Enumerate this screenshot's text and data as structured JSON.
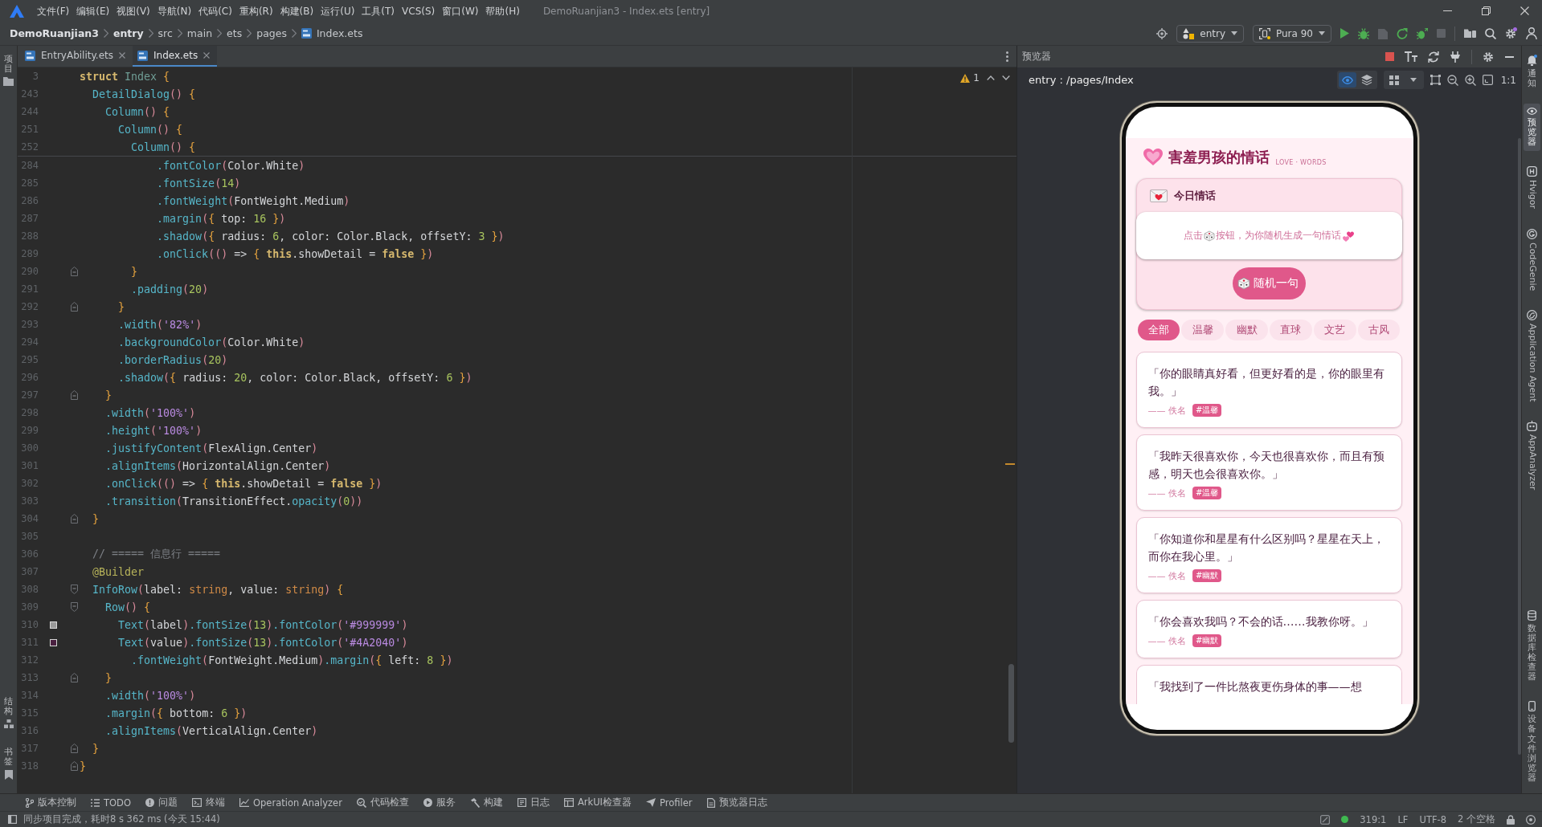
{
  "menu_bar": {
    "items": [
      "文件(F)",
      "编辑(E)",
      "视图(V)",
      "导航(N)",
      "代码(C)",
      "重构(R)",
      "构建(B)",
      "运行(U)",
      "工具(T)",
      "VCS(S)",
      "窗口(W)",
      "帮助(H)"
    ],
    "title": "DemoRuanjian3 - Index.ets [entry]"
  },
  "nav_bar": {
    "breadcrumbs": [
      {
        "label": "DemoRuanjian3",
        "bold": true,
        "kind": "folder"
      },
      {
        "label": "entry",
        "bold": true,
        "kind": "folder"
      },
      {
        "label": "src",
        "bold": false,
        "kind": "folder"
      },
      {
        "label": "main",
        "bold": false,
        "kind": "folder"
      },
      {
        "label": "ets",
        "bold": false,
        "kind": "folder"
      },
      {
        "label": "pages",
        "bold": false,
        "kind": "folder"
      },
      {
        "label": "Index.ets",
        "bold": false,
        "kind": "file"
      }
    ],
    "module": "entry",
    "device": "Pura 90"
  },
  "left_stripe": {
    "top_items": [
      "项目"
    ],
    "bottom_items": [
      "结构",
      "书签"
    ]
  },
  "editor": {
    "tabs": [
      {
        "label": "EntryAbility.ets",
        "selected": false
      },
      {
        "label": "Index.ets",
        "selected": true
      }
    ],
    "warning_count": "1",
    "sticky_lines": [
      {
        "number": "3",
        "tokens": [
          {
            "kind": "kw",
            "text": "struct"
          },
          {
            "kind": "type",
            "text": " Index"
          },
          {
            "kind": "brace",
            "text": " {"
          }
        ]
      },
      {
        "number": "243",
        "tokens": [
          {
            "kind": "fn",
            "text": "  DetailDialog"
          },
          {
            "kind": "paren",
            "text": "()"
          },
          {
            "kind": "brace",
            "text": " {"
          }
        ]
      },
      {
        "number": "244",
        "tokens": [
          {
            "kind": "fn",
            "text": "    Column"
          },
          {
            "kind": "paren",
            "text": "()"
          },
          {
            "kind": "brace",
            "text": " {"
          }
        ]
      },
      {
        "number": "251",
        "tokens": [
          {
            "kind": "fn",
            "text": "      Column"
          },
          {
            "kind": "paren",
            "text": "()"
          },
          {
            "kind": "brace",
            "text": " {"
          }
        ]
      },
      {
        "number": "252",
        "tokens": [
          {
            "kind": "fn",
            "text": "        Column"
          },
          {
            "kind": "paren",
            "text": "()"
          },
          {
            "kind": "brace",
            "text": " {"
          }
        ]
      }
    ],
    "lines": [
      {
        "number": "284",
        "kind": "plain",
        "tokens": [
          {
            "kind": "fn",
            "text": "            .fontColor"
          },
          {
            "kind": "paren",
            "text": "("
          },
          {
            "kind": "id",
            "text": "Color.White"
          },
          {
            "kind": "paren",
            "text": ")"
          }
        ]
      },
      {
        "number": "285",
        "kind": "plain",
        "tokens": [
          {
            "kind": "fn",
            "text": "            .fontSize"
          },
          {
            "kind": "paren",
            "text": "("
          },
          {
            "kind": "num",
            "text": "14"
          },
          {
            "kind": "paren",
            "text": ")"
          }
        ]
      },
      {
        "number": "286",
        "kind": "plain",
        "tokens": [
          {
            "kind": "fn",
            "text": "            .fontWeight"
          },
          {
            "kind": "paren",
            "text": "("
          },
          {
            "kind": "id",
            "text": "FontWeight.Medium"
          },
          {
            "kind": "paren",
            "text": ")"
          }
        ]
      },
      {
        "number": "287",
        "kind": "plain",
        "tokens": [
          {
            "kind": "fn",
            "text": "            .margin"
          },
          {
            "kind": "paren",
            "text": "("
          },
          {
            "kind": "brace",
            "text": "{"
          },
          {
            "kind": "id",
            "text": " top: "
          },
          {
            "kind": "num",
            "text": "16"
          },
          {
            "kind": "brace",
            "text": " }"
          },
          {
            "kind": "paren",
            "text": ")"
          }
        ]
      },
      {
        "number": "288",
        "kind": "plain",
        "tokens": [
          {
            "kind": "fn",
            "text": "            .shadow"
          },
          {
            "kind": "paren",
            "text": "("
          },
          {
            "kind": "brace",
            "text": "{"
          },
          {
            "kind": "id",
            "text": " radius: "
          },
          {
            "kind": "num",
            "text": "6"
          },
          {
            "kind": "id",
            "text": ", color: Color.Black, offsetY: "
          },
          {
            "kind": "num",
            "text": "3"
          },
          {
            "kind": "brace",
            "text": " }"
          },
          {
            "kind": "paren",
            "text": ")"
          }
        ]
      },
      {
        "number": "289",
        "kind": "plain",
        "tokens": [
          {
            "kind": "fn",
            "text": "            .onClick"
          },
          {
            "kind": "paren",
            "text": "(()"
          },
          {
            "kind": "id",
            "text": " => "
          },
          {
            "kind": "brace",
            "text": "{"
          },
          {
            "kind": "kw",
            "text": " this"
          },
          {
            "kind": "id",
            "text": ".showDetail = "
          },
          {
            "kind": "kw",
            "text": "false"
          },
          {
            "kind": "brace",
            "text": " }"
          },
          {
            "kind": "paren",
            "text": ")"
          }
        ]
      },
      {
        "number": "290",
        "kind": "closer",
        "tokens": [
          {
            "kind": "brace",
            "text": "        }"
          }
        ]
      },
      {
        "number": "291",
        "kind": "plain",
        "tokens": [
          {
            "kind": "fn",
            "text": "        .padding"
          },
          {
            "kind": "paren",
            "text": "("
          },
          {
            "kind": "num",
            "text": "20"
          },
          {
            "kind": "paren",
            "text": ")"
          }
        ]
      },
      {
        "number": "292",
        "kind": "closer",
        "tokens": [
          {
            "kind": "brace",
            "text": "      }"
          }
        ]
      },
      {
        "number": "293",
        "kind": "plain",
        "tokens": [
          {
            "kind": "fn",
            "text": "      .width"
          },
          {
            "kind": "paren",
            "text": "("
          },
          {
            "kind": "str",
            "text": "'82%'"
          },
          {
            "kind": "paren",
            "text": ")"
          }
        ]
      },
      {
        "number": "294",
        "kind": "plain",
        "tokens": [
          {
            "kind": "fn",
            "text": "      .backgroundColor"
          },
          {
            "kind": "paren",
            "text": "("
          },
          {
            "kind": "id",
            "text": "Color.White"
          },
          {
            "kind": "paren",
            "text": ")"
          }
        ]
      },
      {
        "number": "295",
        "kind": "plain",
        "tokens": [
          {
            "kind": "fn",
            "text": "      .borderRadius"
          },
          {
            "kind": "paren",
            "text": "("
          },
          {
            "kind": "num",
            "text": "20"
          },
          {
            "kind": "paren",
            "text": ")"
          }
        ]
      },
      {
        "number": "296",
        "kind": "plain",
        "tokens": [
          {
            "kind": "fn",
            "text": "      .shadow"
          },
          {
            "kind": "paren",
            "text": "("
          },
          {
            "kind": "brace",
            "text": "{"
          },
          {
            "kind": "id",
            "text": " radius: "
          },
          {
            "kind": "num",
            "text": "20"
          },
          {
            "kind": "id",
            "text": ", color: Color.Black, offsetY: "
          },
          {
            "kind": "num",
            "text": "6"
          },
          {
            "kind": "brace",
            "text": " }"
          },
          {
            "kind": "paren",
            "text": ")"
          }
        ]
      },
      {
        "number": "297",
        "kind": "closer",
        "tokens": [
          {
            "kind": "brace",
            "text": "    }"
          }
        ]
      },
      {
        "number": "298",
        "kind": "plain",
        "tokens": [
          {
            "kind": "fn",
            "text": "    .width"
          },
          {
            "kind": "paren",
            "text": "("
          },
          {
            "kind": "str",
            "text": "'100%'"
          },
          {
            "kind": "paren",
            "text": ")"
          }
        ]
      },
      {
        "number": "299",
        "kind": "plain",
        "tokens": [
          {
            "kind": "fn",
            "text": "    .height"
          },
          {
            "kind": "paren",
            "text": "("
          },
          {
            "kind": "str",
            "text": "'100%'"
          },
          {
            "kind": "paren",
            "text": ")"
          }
        ]
      },
      {
        "number": "300",
        "kind": "plain",
        "tokens": [
          {
            "kind": "fn",
            "text": "    .justifyContent"
          },
          {
            "kind": "paren",
            "text": "("
          },
          {
            "kind": "id",
            "text": "FlexAlign.Center"
          },
          {
            "kind": "paren",
            "text": ")"
          }
        ]
      },
      {
        "number": "301",
        "kind": "plain",
        "tokens": [
          {
            "kind": "fn",
            "text": "    .alignItems"
          },
          {
            "kind": "paren",
            "text": "("
          },
          {
            "kind": "id",
            "text": "HorizontalAlign.Center"
          },
          {
            "kind": "paren",
            "text": ")"
          }
        ]
      },
      {
        "number": "302",
        "kind": "plain",
        "tokens": [
          {
            "kind": "fn",
            "text": "    .onClick"
          },
          {
            "kind": "paren",
            "text": "(()"
          },
          {
            "kind": "id",
            "text": " => "
          },
          {
            "kind": "brace",
            "text": "{"
          },
          {
            "kind": "kw",
            "text": " this"
          },
          {
            "kind": "id",
            "text": ".showDetail = "
          },
          {
            "kind": "kw",
            "text": "false"
          },
          {
            "kind": "brace",
            "text": " }"
          },
          {
            "kind": "paren",
            "text": ")"
          }
        ]
      },
      {
        "number": "303",
        "kind": "plain",
        "tokens": [
          {
            "kind": "fn",
            "text": "    .transition"
          },
          {
            "kind": "paren",
            "text": "("
          },
          {
            "kind": "id",
            "text": "TransitionEffect."
          },
          {
            "kind": "fn",
            "text": "opacity"
          },
          {
            "kind": "paren",
            "text": "("
          },
          {
            "kind": "num",
            "text": "0"
          },
          {
            "kind": "paren",
            "text": "))"
          }
        ]
      },
      {
        "number": "304",
        "kind": "closer",
        "tokens": [
          {
            "kind": "brace",
            "text": "  }"
          }
        ]
      },
      {
        "number": "305",
        "kind": "plain"
      },
      {
        "number": "306",
        "kind": "plain",
        "tokens": [
          {
            "kind": "comment",
            "text": "  // ===== 信息行 ====="
          }
        ]
      },
      {
        "number": "307",
        "kind": "plain",
        "tokens": [
          {
            "kind": "deco",
            "text": "  @Builder"
          }
        ]
      },
      {
        "number": "308",
        "kind": "opener",
        "tokens": [
          {
            "kind": "fn",
            "text": "  InfoRow"
          },
          {
            "kind": "paren",
            "text": "("
          },
          {
            "kind": "id",
            "text": "label: "
          },
          {
            "kind": "tp",
            "text": "string"
          },
          {
            "kind": "id",
            "text": ", value: "
          },
          {
            "kind": "tp",
            "text": "string"
          },
          {
            "kind": "paren",
            "text": ")"
          },
          {
            "kind": "brace",
            "text": " {"
          }
        ]
      },
      {
        "number": "309",
        "kind": "opener",
        "tokens": [
          {
            "kind": "fn",
            "text": "    Row"
          },
          {
            "kind": "paren",
            "text": "()"
          },
          {
            "kind": "brace",
            "text": " {"
          }
        ]
      },
      {
        "number": "310",
        "kind": "plain",
        "color": "#999999",
        "tokens": [
          {
            "kind": "fn",
            "text": "      Text"
          },
          {
            "kind": "paren",
            "text": "("
          },
          {
            "kind": "id",
            "text": "label"
          },
          {
            "kind": "paren",
            "text": ")"
          },
          {
            "kind": "fn",
            "text": ".fontSize"
          },
          {
            "kind": "paren",
            "text": "("
          },
          {
            "kind": "num",
            "text": "13"
          },
          {
            "kind": "paren",
            "text": ")"
          },
          {
            "kind": "fn",
            "text": ".fontColor"
          },
          {
            "kind": "paren",
            "text": "("
          },
          {
            "kind": "str",
            "text": "'#999999'"
          },
          {
            "kind": "paren",
            "text": ")"
          }
        ]
      },
      {
        "number": "311",
        "kind": "plain",
        "color": "#4a2040",
        "tokens": [
          {
            "kind": "fn",
            "text": "      Text"
          },
          {
            "kind": "paren",
            "text": "("
          },
          {
            "kind": "id",
            "text": "value"
          },
          {
            "kind": "paren",
            "text": ")"
          },
          {
            "kind": "fn",
            "text": ".fontSize"
          },
          {
            "kind": "paren",
            "text": "("
          },
          {
            "kind": "num",
            "text": "13"
          },
          {
            "kind": "paren",
            "text": ")"
          },
          {
            "kind": "fn",
            "text": ".fontColor"
          },
          {
            "kind": "paren",
            "text": "("
          },
          {
            "kind": "str",
            "text": "'#4A2040'"
          },
          {
            "kind": "paren",
            "text": ")"
          }
        ]
      },
      {
        "number": "312",
        "kind": "plain",
        "tokens": [
          {
            "kind": "fn",
            "text": "        .fontWeight"
          },
          {
            "kind": "paren",
            "text": "("
          },
          {
            "kind": "id",
            "text": "FontWeight.Medium"
          },
          {
            "kind": "paren",
            "text": ")"
          },
          {
            "kind": "fn",
            "text": ".margin"
          },
          {
            "kind": "paren",
            "text": "("
          },
          {
            "kind": "brace",
            "text": "{"
          },
          {
            "kind": "id",
            "text": " left: "
          },
          {
            "kind": "num",
            "text": "8"
          },
          {
            "kind": "brace",
            "text": " }"
          },
          {
            "kind": "paren",
            "text": ")"
          }
        ]
      },
      {
        "number": "313",
        "kind": "closer",
        "tokens": [
          {
            "kind": "brace",
            "text": "    }"
          }
        ]
      },
      {
        "number": "314",
        "kind": "plain",
        "tokens": [
          {
            "kind": "fn",
            "text": "    .width"
          },
          {
            "kind": "paren",
            "text": "("
          },
          {
            "kind": "str",
            "text": "'100%'"
          },
          {
            "kind": "paren",
            "text": ")"
          }
        ]
      },
      {
        "number": "315",
        "kind": "plain",
        "tokens": [
          {
            "kind": "fn",
            "text": "    .margin"
          },
          {
            "kind": "paren",
            "text": "("
          },
          {
            "kind": "brace",
            "text": "{"
          },
          {
            "kind": "id",
            "text": " bottom: "
          },
          {
            "kind": "num",
            "text": "6"
          },
          {
            "kind": "brace",
            "text": " }"
          },
          {
            "kind": "paren",
            "text": ")"
          }
        ]
      },
      {
        "number": "316",
        "kind": "plain",
        "tokens": [
          {
            "kind": "fn",
            "text": "    .alignItems"
          },
          {
            "kind": "paren",
            "text": "("
          },
          {
            "kind": "id",
            "text": "VerticalAlign.Center"
          },
          {
            "kind": "paren",
            "text": ")"
          }
        ]
      },
      {
        "number": "317",
        "kind": "closer",
        "tokens": [
          {
            "kind": "brace",
            "text": "  }"
          }
        ]
      },
      {
        "number": "318",
        "kind": "closer",
        "tokens": [
          {
            "kind": "brace",
            "text": "}"
          }
        ]
      }
    ]
  },
  "preview": {
    "title": "预览器",
    "path": "entry : /pages/Index",
    "view_toggles": [
      {
        "selected": true
      },
      {
        "selected": false
      }
    ],
    "zoom_label": "1:1",
    "app": {
      "title": "害羞男孩的情话",
      "subtitle": "LOVE · WORDS",
      "today": {
        "title": "今日情话",
        "hint": [
          "点击",
          "按钮，为你随机生成一句情话"
        ],
        "button": "随机一句"
      },
      "filters": [
        {
          "label": "全部",
          "selected": true
        },
        {
          "label": "温馨",
          "selected": false
        },
        {
          "label": "幽默",
          "selected": false
        },
        {
          "label": "直球",
          "selected": false
        },
        {
          "label": "文艺",
          "selected": false
        },
        {
          "label": "古风",
          "selected": false
        }
      ],
      "quotes": [
        {
          "text": "「你的眼睛真好看，但更好看的是，你的眼里有我。」",
          "author": "—— 佚名",
          "tag": "#温馨"
        },
        {
          "text": "「我昨天很喜欢你，今天也很喜欢你，而且有预感，明天也会很喜欢你。」",
          "author": "—— 佚名",
          "tag": "#温馨"
        },
        {
          "text": "「你知道你和星星有什么区别吗？星星在天上，而你在我心里。」",
          "author": "—— 佚名",
          "tag": "#幽默"
        },
        {
          "text": "「你会喜欢我吗？不会的话……我教你呀。」",
          "author": "—— 佚名",
          "tag": "#幽默"
        },
        {
          "text": "「我找到了一件比熬夜更伤身体的事——想"
        }
      ]
    }
  },
  "right_stripe": {
    "top_items": [
      {
        "label": "通知",
        "kind": "cjk",
        "selected": false
      },
      {
        "label": "预览器",
        "kind": "cjk",
        "selected": true
      },
      {
        "label": "Hvigor",
        "kind": "latin",
        "selected": false
      },
      {
        "label": "CodeGenie",
        "kind": "latin",
        "selected": false
      },
      {
        "label": "Application Agent",
        "kind": "latin",
        "selected": false
      },
      {
        "label": "AppAnalyzer",
        "kind": "latin",
        "selected": false
      }
    ],
    "bottom_items": [
      {
        "label": "数据库检查器",
        "kind": "cjk",
        "selected": false
      },
      {
        "label": "设备文件浏览器",
        "kind": "cjk",
        "selected": false
      }
    ]
  },
  "tool_bar": {
    "items": [
      "版本控制",
      "TODO",
      "问题",
      "终端",
      "Operation Analyzer",
      "代码检查",
      "服务",
      "构建",
      "日志",
      "ArkUI检查器",
      "Profiler",
      "预览器日志"
    ]
  },
  "status_bar": {
    "message": "同步项目完成，耗时8 s 362 ms (今天 15:44)",
    "position": "319:1",
    "line_separator": "LF",
    "encoding": "UTF-8",
    "indent": "2 个空格"
  }
}
